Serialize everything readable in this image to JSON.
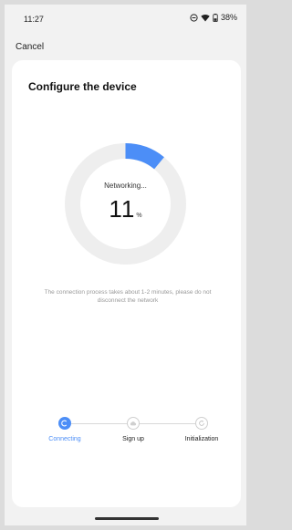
{
  "status_bar": {
    "time": "11:27",
    "battery": "38%"
  },
  "header": {
    "cancel_label": "Cancel"
  },
  "card": {
    "title": "Configure the device",
    "progress": {
      "label": "Networking...",
      "value": "11",
      "unit": "%",
      "percent": 11
    },
    "hint": "The connection process takes about 1-2 minutes, please do not disconnect the network",
    "steps": [
      {
        "label": "Connecting",
        "state": "active",
        "icon": "link-icon"
      },
      {
        "label": "Sign up",
        "state": "pending",
        "icon": "cloud-icon"
      },
      {
        "label": "Initialization",
        "state": "pending",
        "icon": "refresh-icon"
      }
    ]
  },
  "colors": {
    "accent": "#4c8ef7",
    "track": "#eeeeee"
  }
}
